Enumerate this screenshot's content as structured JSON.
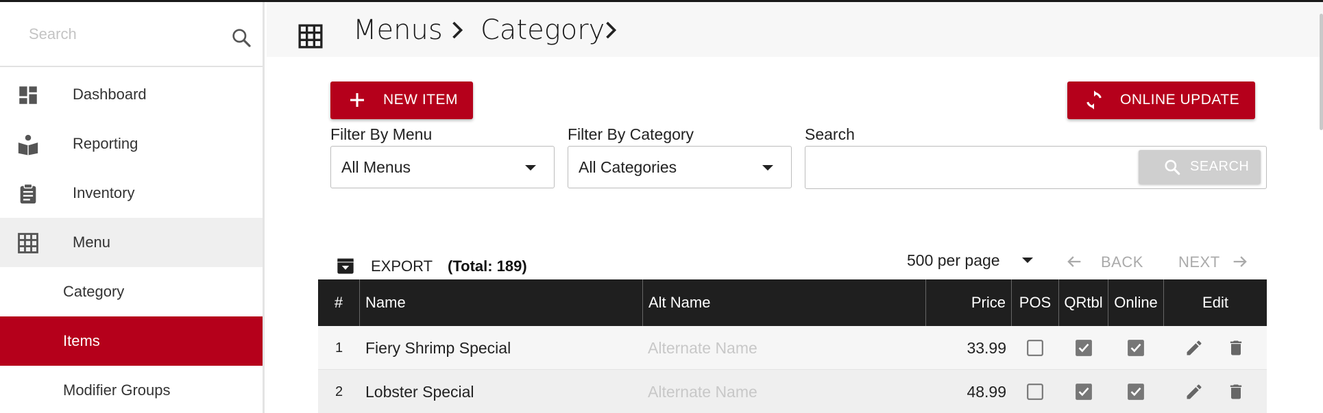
{
  "sidebar": {
    "search_placeholder": "Search",
    "items": [
      {
        "label": "Dashboard",
        "icon": "dashboard-icon"
      },
      {
        "label": "Reporting",
        "icon": "book-icon"
      },
      {
        "label": "Inventory",
        "icon": "clipboard-icon"
      },
      {
        "label": "Menu",
        "icon": "grid-icon"
      }
    ],
    "sub_items": [
      {
        "label": "Category"
      },
      {
        "label": "Items"
      },
      {
        "label": "Modifier Groups"
      }
    ]
  },
  "header": {
    "breadcrumb": [
      "Menus",
      "Category"
    ]
  },
  "toolbar": {
    "new_item_label": "NEW ITEM",
    "online_update_label": "ONLINE UPDATE"
  },
  "filters": {
    "menu_label": "Filter By Menu",
    "menu_value": "All Menus",
    "category_label": "Filter By Category",
    "category_value": "All Categories",
    "search_label": "Search",
    "search_value": "",
    "search_button": "SEARCH"
  },
  "list_controls": {
    "export_label": "EXPORT",
    "total_label": "(Total: 189)",
    "per_page": "500 per page",
    "back_label": "BACK",
    "next_label": "NEXT"
  },
  "table": {
    "columns": [
      "#",
      "Name",
      "Alt Name",
      "Price",
      "POS",
      "QRtbl",
      "Online",
      "Edit"
    ],
    "rows": [
      {
        "num": "1",
        "name": "Fiery Shrimp Special",
        "alt_name": "Alternate Name",
        "price": "33.99",
        "pos": false,
        "qrtbl": true,
        "online": true
      },
      {
        "num": "2",
        "name": "Lobster Special",
        "alt_name": "Alternate Name",
        "price": "48.99",
        "pos": false,
        "qrtbl": true,
        "online": true
      }
    ]
  },
  "colors": {
    "accent": "#b5001b",
    "header_bg": "#1f1f1f",
    "disabled": "#cfcfcf"
  }
}
